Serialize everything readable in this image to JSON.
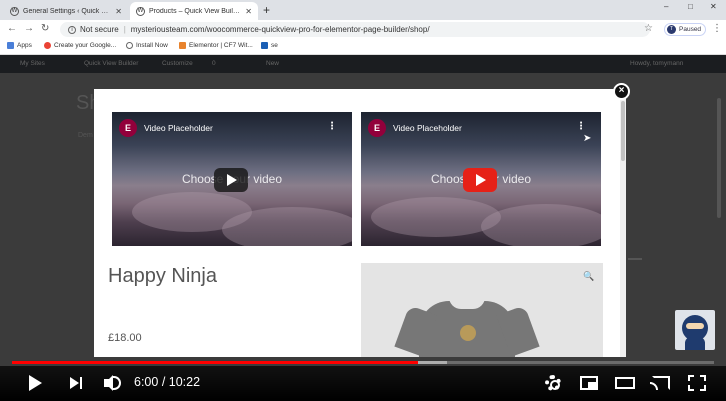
{
  "browser": {
    "tabs": [
      {
        "title": "General Settings ‹ Quick View El…",
        "active": false
      },
      {
        "title": "Products – Quick View Builder",
        "active": true
      }
    ],
    "new_tab": "+",
    "window_controls": {
      "minimize": "–",
      "maximize": "□",
      "close": "✕"
    },
    "address": {
      "security": "Not secure",
      "url": "mysteriousteam.com/woocommerce-quickview-pro-for-elementor-page-builder/shop/"
    },
    "profile": {
      "initial": "T",
      "status": "Paused"
    },
    "bookmarks": [
      "Apps",
      "Create your Google...",
      "Install Now",
      "Elementor | CF7 Wit...",
      "se"
    ]
  },
  "wp_admin_bar": [
    "My Sites",
    "Quick View Builder",
    "Customize",
    "0",
    "New",
    "Howdy, tomymann"
  ],
  "page_background": {
    "title": "Sh",
    "subtitle": "Dem"
  },
  "modal": {
    "close_label": "×",
    "videos": [
      {
        "title": "Video Placeholder",
        "center_text": "Choose your video",
        "play_state": "idle"
      },
      {
        "title": "Video Placeholder",
        "center_text": "Choose your video",
        "play_state": "hover"
      }
    ],
    "product": {
      "title": "Happy Ninja",
      "price": "£18.00"
    }
  },
  "player": {
    "current_time": "6:00",
    "duration": "10:22",
    "progress_fraction": 0.579,
    "buffered_fraction": 0.62,
    "progress_color": "#ff0000"
  },
  "colors": {
    "elementor": "#92003b",
    "youtube_red": "#e62117"
  }
}
